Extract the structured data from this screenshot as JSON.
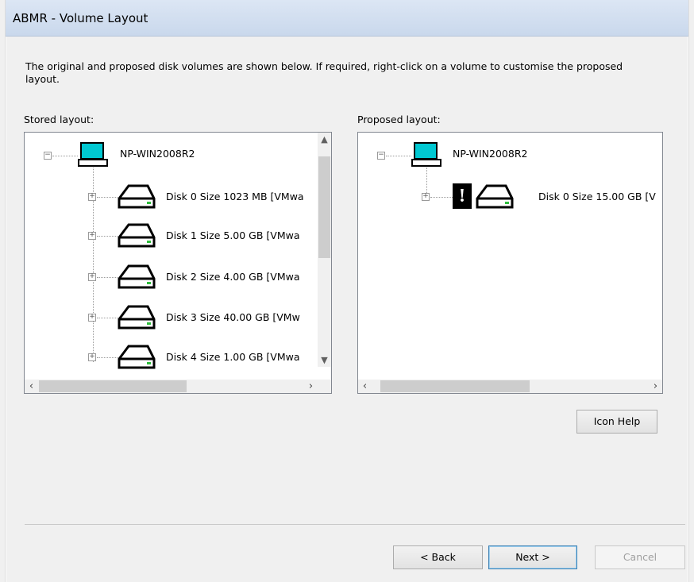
{
  "window": {
    "title": "ABMR - Volume Layout"
  },
  "description": "The original and proposed disk volumes are shown below. If required, right-click on a volume to customise the proposed layout.",
  "stored": {
    "label": "Stored layout:",
    "root": "NP-WIN2008R2",
    "disks": [
      {
        "label": "Disk 0 Size  1023 MB [VMwa"
      },
      {
        "label": "Disk 1 Size   5.00 GB [VMwa"
      },
      {
        "label": "Disk 2 Size   4.00 GB [VMwa"
      },
      {
        "label": "Disk 3 Size  40.00 GB [VMw"
      },
      {
        "label": "Disk 4 Size   1.00 GB [VMwa"
      }
    ]
  },
  "proposed": {
    "label": "Proposed layout:",
    "root": "NP-WIN2008R2",
    "disks": [
      {
        "label": "Disk 0 Size  15.00 GB [V"
      }
    ]
  },
  "buttons": {
    "icon_help": "Icon Help",
    "back": "< Back",
    "next": "Next >",
    "cancel": "Cancel"
  },
  "icons": {
    "computer": "computer-icon",
    "disk": "hard-disk-icon",
    "warning": "exclamation-warning-icon",
    "expand": "plus-expander-icon",
    "collapse": "minus-expander-icon"
  },
  "colors": {
    "monitor_screen": "#00c8d2",
    "disk_led": "#2ebd3c"
  }
}
